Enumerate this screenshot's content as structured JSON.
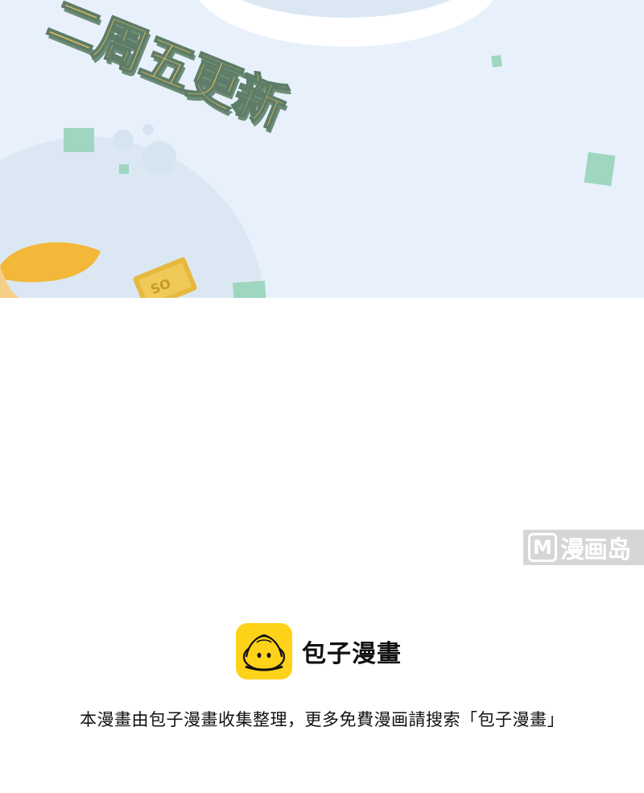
{
  "banner": {
    "update_text": "二周五更新",
    "tag_text": "SO",
    "colors": {
      "sky": "#e8f1fb",
      "circle": "#dbe8f3",
      "green": "#9fd6c0",
      "yellow": "#f2c45a"
    }
  },
  "watermark": {
    "letter": "M",
    "text": "漫画岛"
  },
  "brand": {
    "name": "包子漫畫",
    "logo_color": "#ffd21a"
  },
  "footer": {
    "text": "本漫畫由包子漫畫收集整理，更多免費漫画請搜索「包子漫畫」"
  }
}
